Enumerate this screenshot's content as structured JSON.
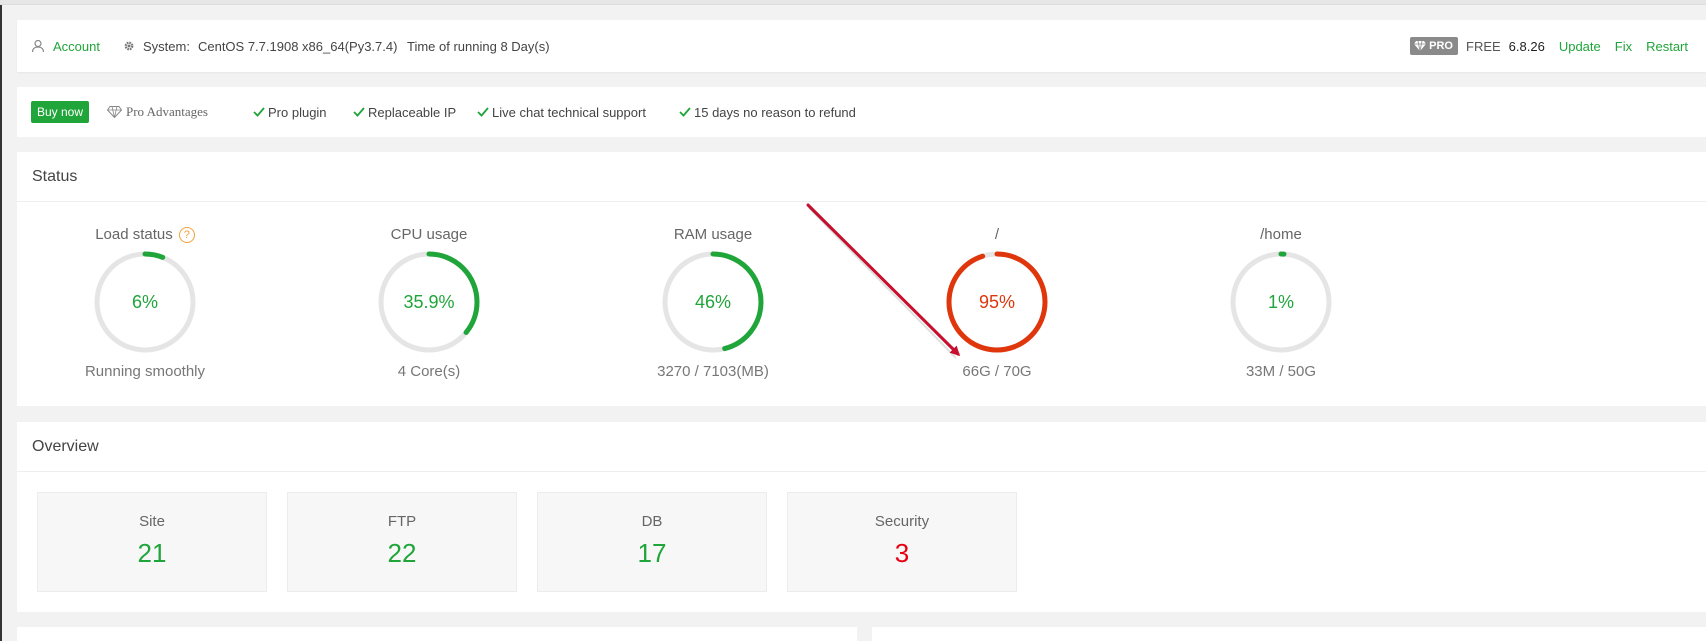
{
  "header": {
    "account": "Account",
    "system_label": "System:",
    "system_value": "CentOS 7.7.1908 x86_64(Py3.7.4)",
    "runtime": "Time of running 8 Day(s)",
    "pro_badge": "PRO",
    "free": "FREE",
    "version": "6.8.26",
    "update": "Update",
    "fix": "Fix",
    "restart": "Restart"
  },
  "pro_bar": {
    "buy_now": "Buy now",
    "pro_advantages": "Pro Advantages",
    "features": [
      "Pro plugin",
      "Replaceable IP",
      "Live chat technical support",
      "15 days no reason to refund"
    ]
  },
  "status": {
    "title": "Status",
    "gauges": [
      {
        "title": "Load status",
        "value": "6%",
        "percent": 6,
        "sub": "Running smoothly",
        "color": "#20a53a",
        "help": "?"
      },
      {
        "title": "CPU usage",
        "value": "35.9%",
        "percent": 35.9,
        "sub": "4 Core(s)",
        "color": "#20a53a"
      },
      {
        "title": "RAM usage",
        "value": "46%",
        "percent": 46,
        "sub": "3270 / 7103(MB)",
        "color": "#20a53a"
      },
      {
        "title": "/",
        "value": "95%",
        "percent": 95,
        "sub": "66G / 70G",
        "color": "#e0360c"
      },
      {
        "title": "/home",
        "value": "1%",
        "percent": 1,
        "sub": "33M / 50G",
        "color": "#20a53a"
      }
    ]
  },
  "overview": {
    "title": "Overview",
    "cards": [
      {
        "label": "Site",
        "value": "21",
        "color": "#20a53a"
      },
      {
        "label": "FTP",
        "value": "22",
        "color": "#20a53a"
      },
      {
        "label": "DB",
        "value": "17",
        "color": "#20a53a"
      },
      {
        "label": "Security",
        "value": "3",
        "color": "#e60012"
      }
    ]
  }
}
